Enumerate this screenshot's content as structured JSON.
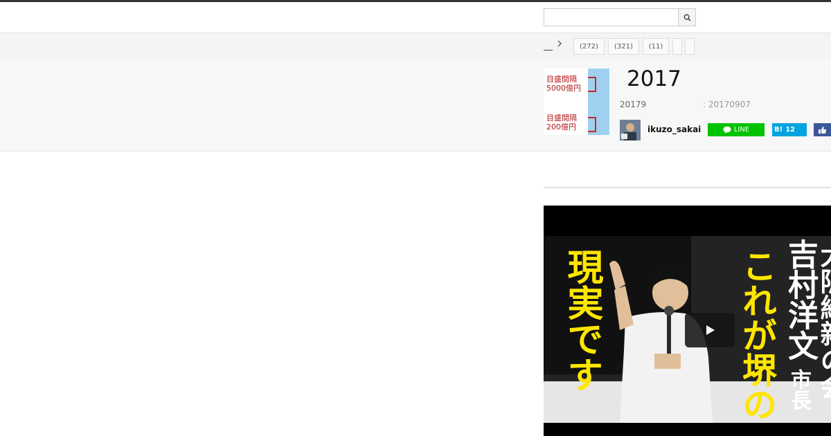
{
  "search": {
    "placeholder": "",
    "value": "",
    "button_icon": "search-icon"
  },
  "nav": {
    "breadcrumb_home": "",
    "categories": [
      {
        "label": "(272)"
      },
      {
        "label": "(321)"
      },
      {
        "label": "(11)"
      },
      {
        "label": ""
      },
      {
        "label": ""
      }
    ]
  },
  "article": {
    "thumbnail_lines": [
      "目盛間隔",
      "5000億円",
      "目盛間隔",
      "200億円"
    ],
    "title": "2017",
    "date_label": "20179",
    "updated_label": ": 20170907",
    "author": "ikuzo_sakai"
  },
  "share": {
    "line_label": "LINE",
    "hatena_label": "B!",
    "hatena_count": "12"
  },
  "video": {
    "caption_left": "現実です",
    "caption_middle": "これが堺の",
    "caption_name": "吉村洋文",
    "caption_title": "市長",
    "caption_right": "大阪維新の会"
  },
  "colors": {
    "line_green": "#00c300",
    "hatena_blue": "#00a4de",
    "facebook_blue": "#3b5998",
    "caption_yellow": "#ffe600"
  }
}
